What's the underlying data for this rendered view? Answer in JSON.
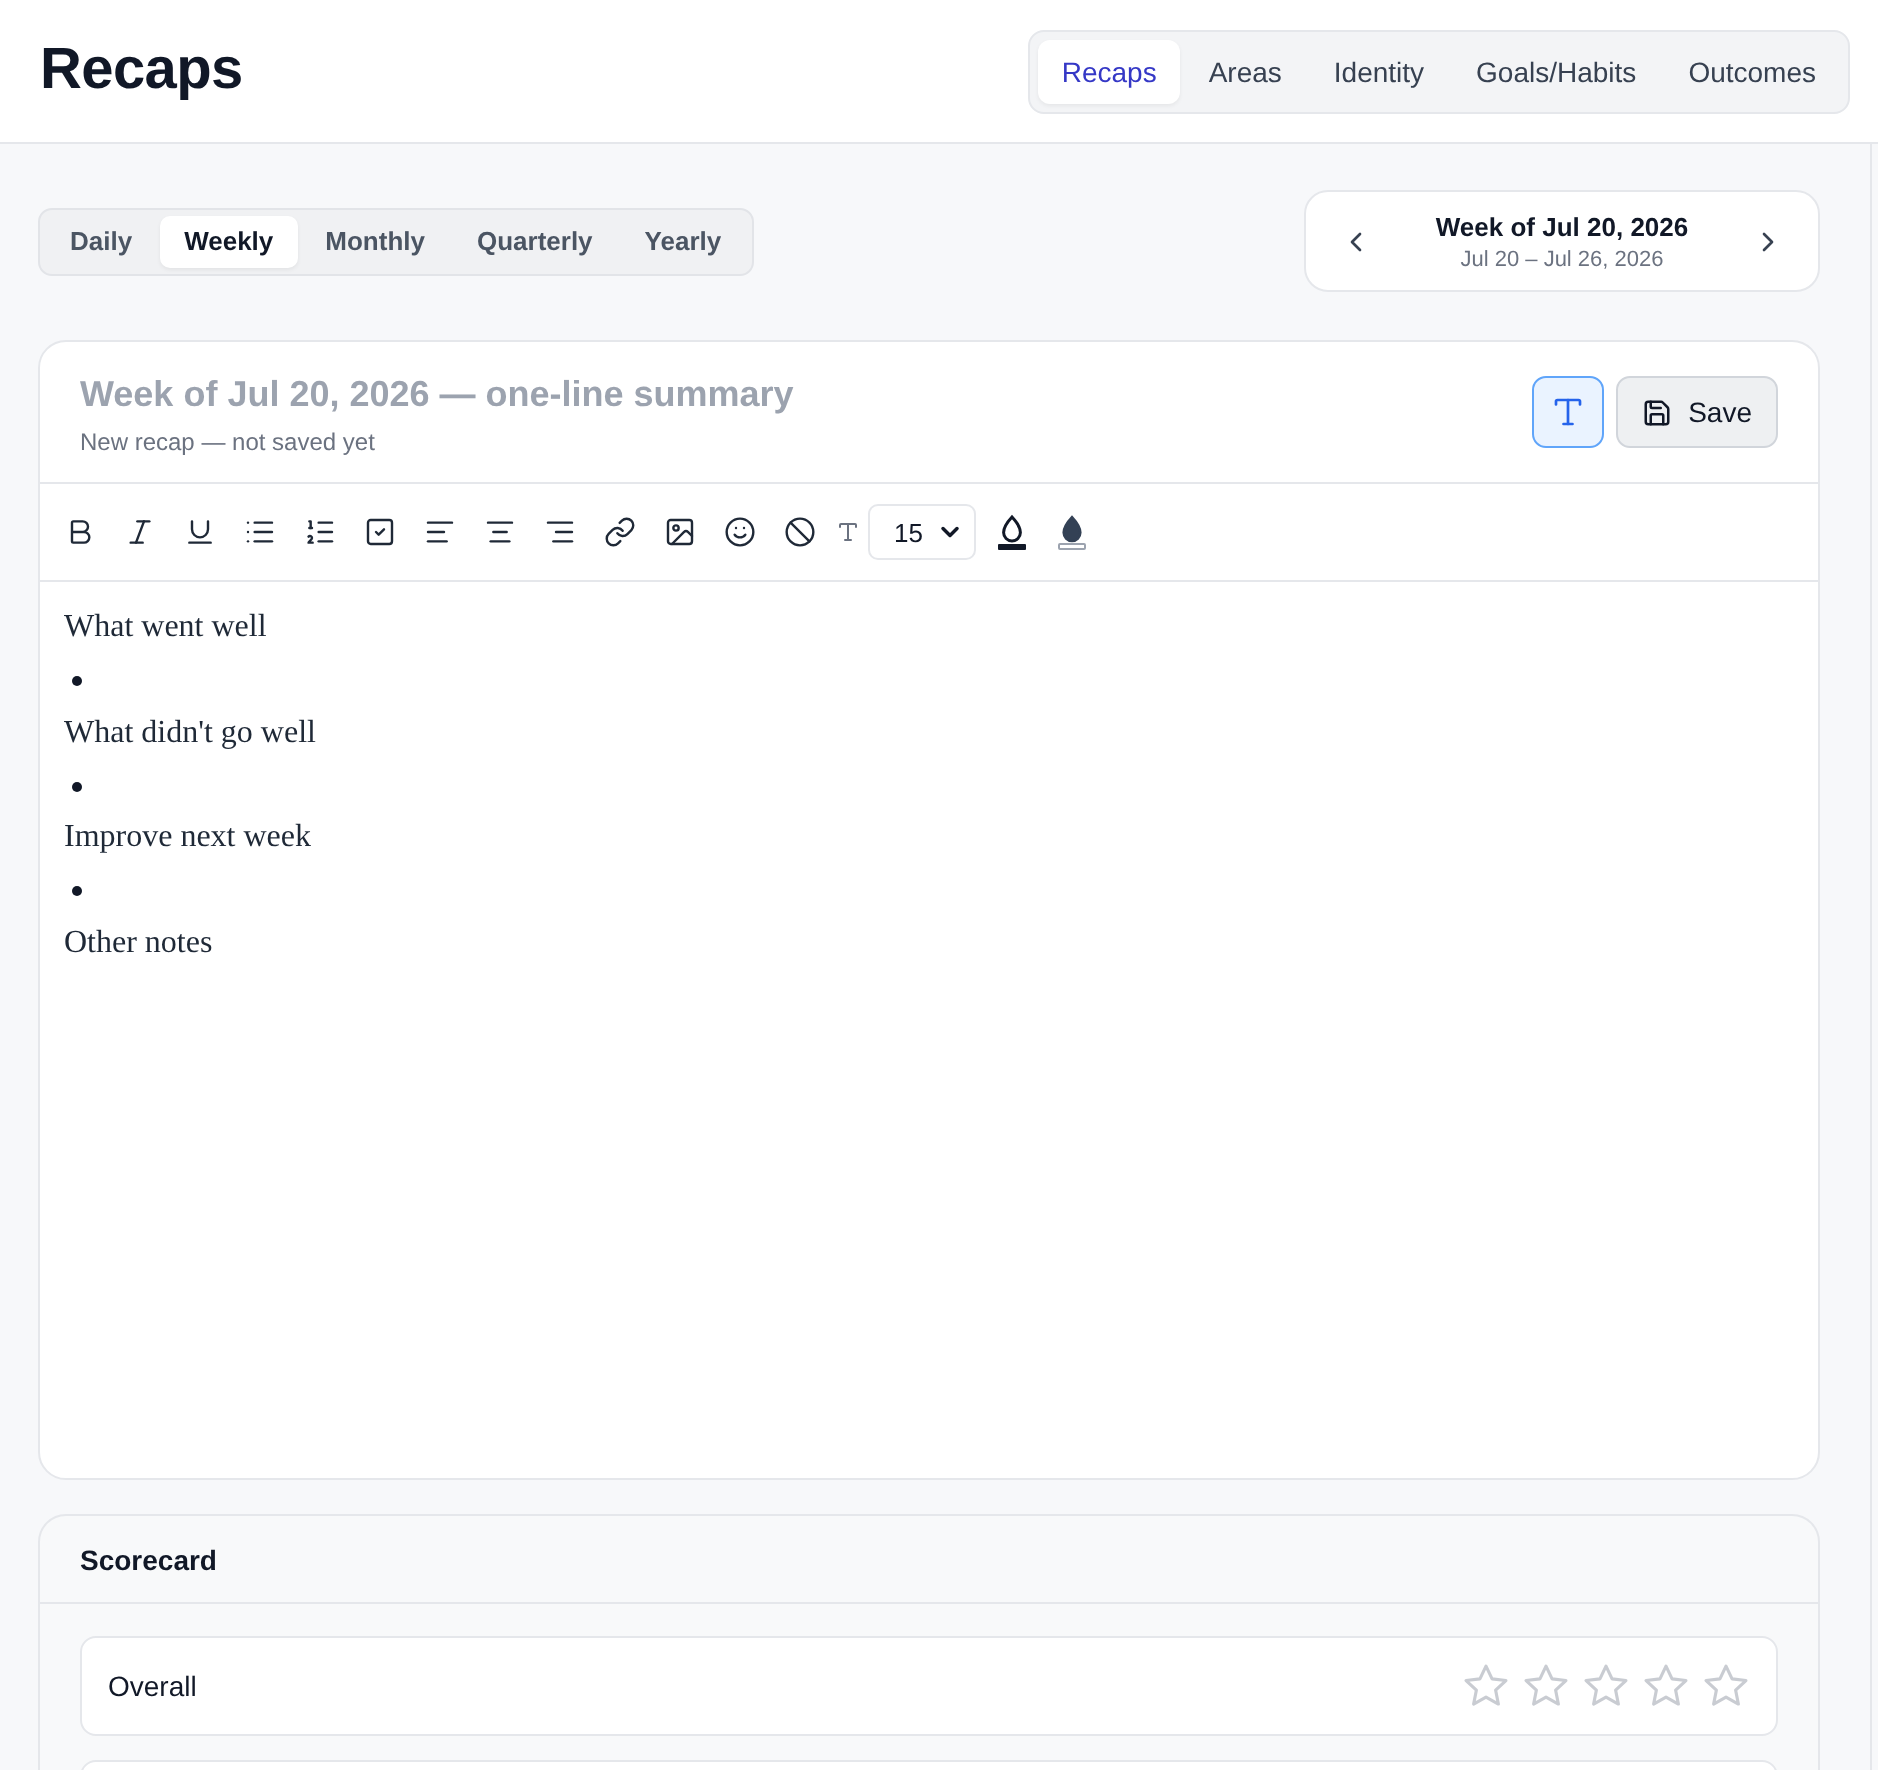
{
  "header": {
    "title": "Recaps"
  },
  "nav_tabs": [
    {
      "label": "Recaps",
      "selected": true
    },
    {
      "label": "Areas",
      "selected": false
    },
    {
      "label": "Identity",
      "selected": false
    },
    {
      "label": "Goals/Habits",
      "selected": false
    },
    {
      "label": "Outcomes",
      "selected": false
    }
  ],
  "period_tabs": [
    {
      "label": "Daily",
      "selected": false
    },
    {
      "label": "Weekly",
      "selected": true
    },
    {
      "label": "Monthly",
      "selected": false
    },
    {
      "label": "Quarterly",
      "selected": false
    },
    {
      "label": "Yearly",
      "selected": false
    }
  ],
  "week_navigator": {
    "title": "Week of Jul 20, 2026",
    "range": "Jul 20 – Jul 26, 2026"
  },
  "editor": {
    "summary": {
      "placeholder": "Week of Jul 20, 2026 — one-line summary"
    },
    "status": "New recap — not saved yet",
    "format_toggle": {
      "on": true
    },
    "save_button": "Save",
    "toolbar": {
      "font_size": "15"
    },
    "content": [
      {
        "kind": "paragraph",
        "text": "What went well"
      },
      {
        "kind": "bullet"
      },
      {
        "kind": "paragraph",
        "text": "What didn't go well"
      },
      {
        "kind": "bullet"
      },
      {
        "kind": "paragraph",
        "text": "Improve next week"
      },
      {
        "kind": "bullet"
      },
      {
        "kind": "paragraph",
        "text": "Other notes"
      }
    ]
  },
  "scorecard": {
    "title": "Scorecard",
    "rows": [
      {
        "label": "Overall",
        "stars": 0
      }
    ]
  }
}
